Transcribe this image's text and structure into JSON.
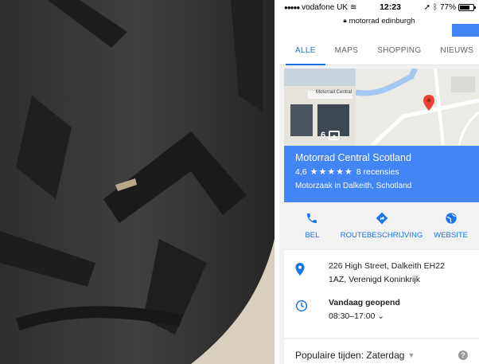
{
  "status_bar": {
    "carrier": "vodafone UK",
    "time": "12:23",
    "battery_percent": "77%",
    "battery_level": 0.77
  },
  "url_bar": {
    "url": "motorrad edinburgh"
  },
  "tabs": [
    {
      "label": "ALLE",
      "active": true
    },
    {
      "label": "MAPS",
      "active": false
    },
    {
      "label": "SHOPPING",
      "active": false
    },
    {
      "label": "NIEUWS",
      "active": false
    }
  ],
  "business": {
    "photo_count": "6",
    "photo_sign_text": "Motorrad Central",
    "name": "Motorrad Central Scotland",
    "rating": "4,6",
    "stars": "★★★★★",
    "reviews": "8 recensies",
    "category": "Motorzaak in Dalkeith, Schotland"
  },
  "actions": [
    {
      "label": "BEL",
      "icon": "phone-icon"
    },
    {
      "label": "ROUTEBESCHRIJVING",
      "icon": "directions-icon"
    },
    {
      "label": "WEBSITE",
      "icon": "globe-icon"
    }
  ],
  "address": {
    "line1": "226 High Street, Dalkeith EH22",
    "line2": "1AZ, Verenigd Koninkrijk"
  },
  "hours": {
    "status": "Vandaag geopend",
    "times": "08:30–17:00"
  },
  "popular_times": {
    "title": "Populaire tijden: Zaterdag"
  },
  "colors": {
    "accent": "#4285f4",
    "link": "#1a73e8",
    "map_pin": "#ea4335"
  }
}
